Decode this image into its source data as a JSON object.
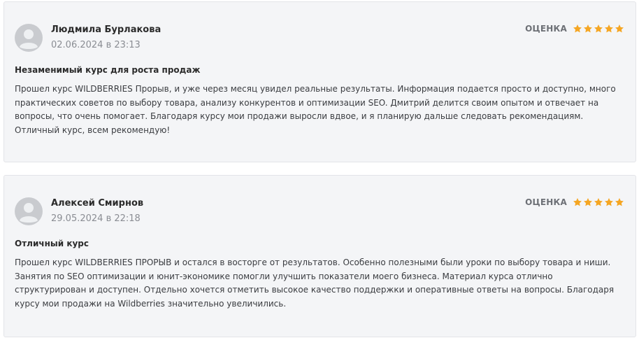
{
  "reviews": [
    {
      "author": "Людмила Бурлакова",
      "date": "02.06.2024 в 23:13",
      "rating_label": "ОЦЕНКА",
      "rating": 5,
      "title": "Незаменимый курс для роста продаж",
      "text": "Прошел курс WILDBERRIES Прорыв, и уже через месяц увидел реальные результаты. Информация подается просто и доступно, много практических советов по выбору товара, анализу конкурентов и оптимизации SEO. Дмитрий делится своим опытом и отвечает на вопросы, что очень помогает. Благодаря курсу мои продажи выросли вдвое, и я планирую дальше следовать рекомендациям. Отличный курс, всем рекомендую!"
    },
    {
      "author": "Алексей Смирнов",
      "date": "29.05.2024 в 22:18",
      "rating_label": "ОЦЕНКА",
      "rating": 5,
      "title": "Отличный курс",
      "text": "Прошел курс WILDBERRIES ПРОРЫВ и остался в восторге от результатов. Особенно полезными были уроки по выбору товара и ниши. Занятия по SEO оптимизации и юнит-экономике помогли улучшить показатели моего бизнеса. Материал курса отлично структурирован и доступен. Отдельно хочется отметить высокое качество поддержки и оперативные ответы на вопросы. Благодаря курсу мои продажи на Wildberries значительно увеличились."
    }
  ],
  "colors": {
    "star": "#f5a623",
    "avatar_bg": "#c9cbcf",
    "avatar_fg": "#eef0f2"
  },
  "icons": {
    "avatar": "user-avatar-icon",
    "star": "star-icon"
  }
}
